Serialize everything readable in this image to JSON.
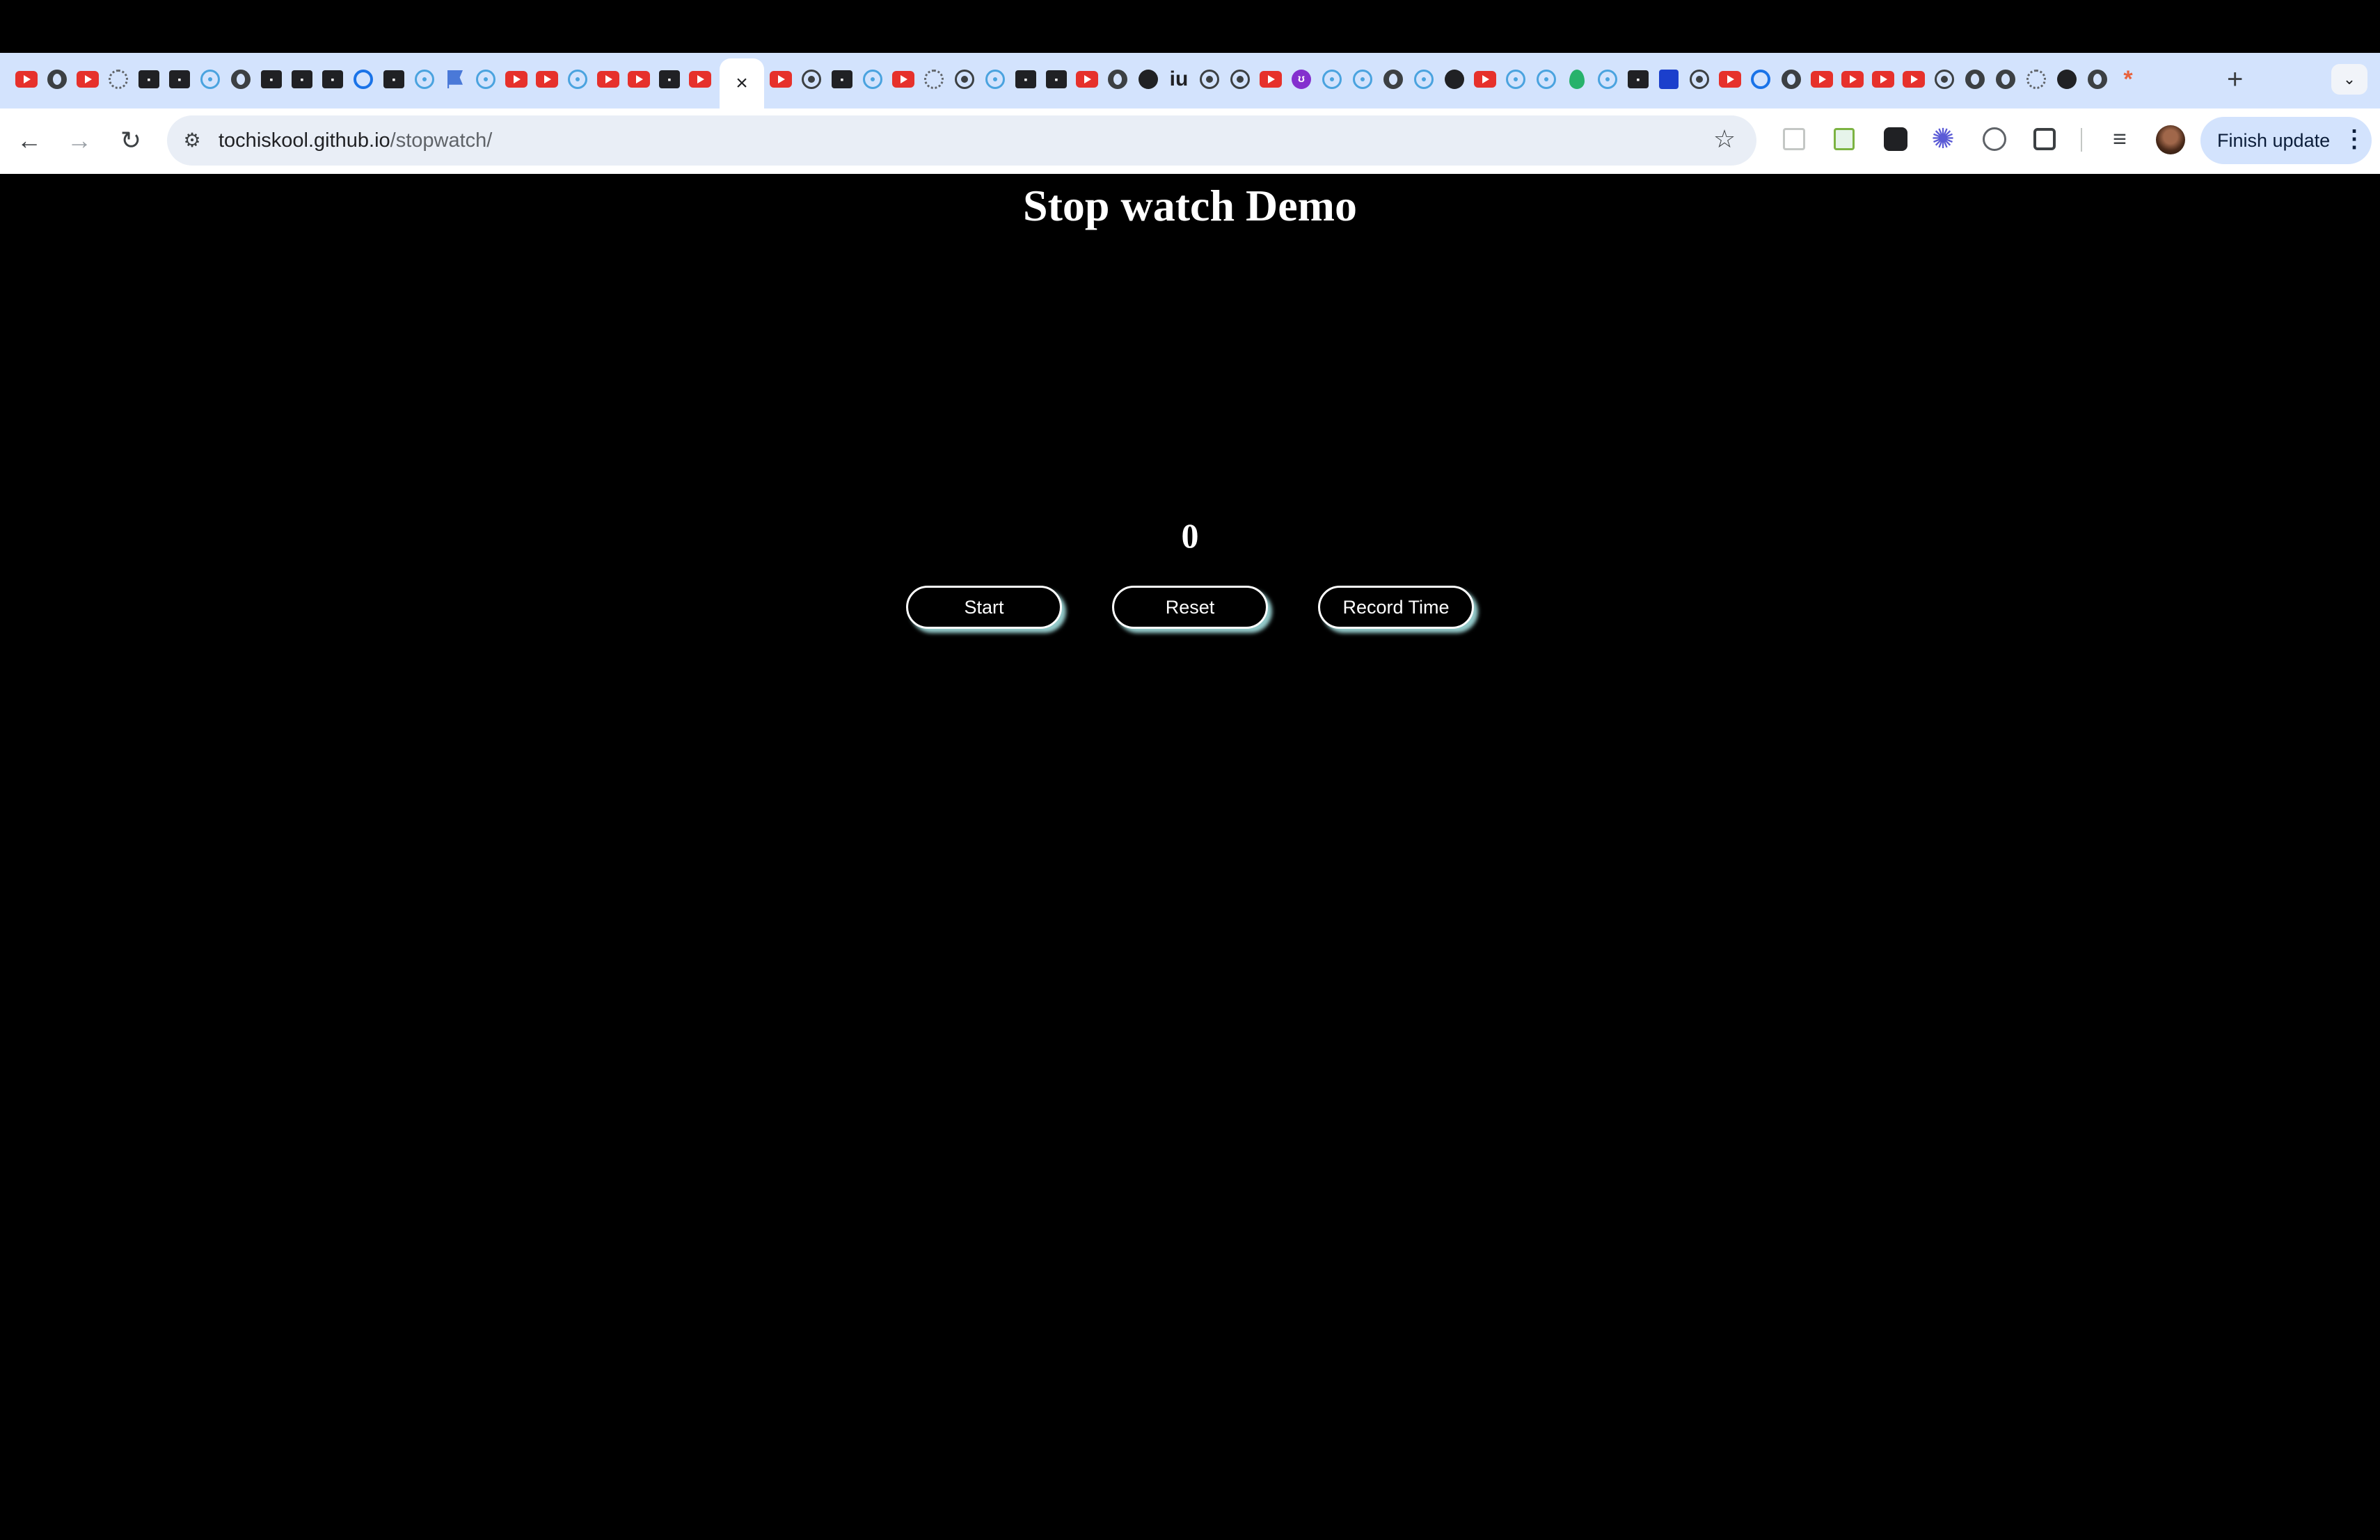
{
  "browser": {
    "active_tab_close": "×",
    "new_tab": "+",
    "tab_search": "⌄",
    "url_host": "tochiskool.github.io",
    "url_path": "/stopwatch/",
    "update_label": "Finish update",
    "update_menu": "⋮",
    "tab_icons": [
      "youtube",
      "globe",
      "youtube",
      "dotted-ring",
      "box",
      "box",
      "react",
      "globe",
      "box",
      "box",
      "box",
      "blue-ring",
      "box",
      "react",
      "flag",
      "react",
      "youtube",
      "youtube",
      "react",
      "youtube",
      "youtube",
      "box",
      "youtube",
      "youtube",
      "target",
      "box",
      "react",
      "youtube",
      "ring",
      "target",
      "react",
      "box",
      "box",
      "youtube",
      "globe",
      "github",
      "iu",
      "target",
      "target",
      "youtube",
      "purple",
      "react",
      "react",
      "globe",
      "react",
      "github",
      "youtube",
      "react",
      "react",
      "green-leaf",
      "react",
      "box",
      "blue-square",
      "target",
      "youtube",
      "blue-ring",
      "globe",
      "youtube",
      "youtube",
      "youtube",
      "youtube",
      "target",
      "globe",
      "globe",
      "ring",
      "github",
      "globe",
      "asterisk"
    ]
  },
  "page": {
    "title": "Stop watch Demo",
    "counter": "0",
    "buttons": {
      "start": "Start",
      "reset": "Reset",
      "record": "Record Time"
    }
  },
  "colors": {
    "page_bg": "#000000",
    "text": "#ffffff",
    "button_glow": "#afeeee",
    "tabstrip": "#d3e3fd"
  }
}
